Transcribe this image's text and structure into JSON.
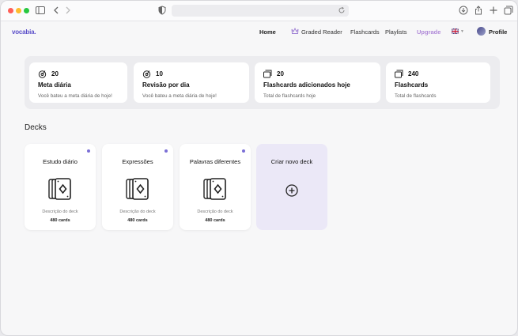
{
  "browser": {
    "icons": [
      "sidebar-icon",
      "back-icon",
      "forward-icon",
      "shield-icon",
      "reload-icon",
      "download-icon",
      "share-icon",
      "new-tab-icon",
      "tabs-icon"
    ]
  },
  "nav": {
    "logo": "vocabia.",
    "home": "Home",
    "graded_reader": "Graded Reader",
    "flashcards": "Flashcards",
    "playlists": "Playlists",
    "upgrade": "Upgrade",
    "profile": "Profile",
    "upgrade_color": "#b08ad8",
    "brand_color": "#5b4fc9"
  },
  "stats": [
    {
      "icon": "target-icon",
      "value": "20",
      "title": "Meta diária",
      "desc": "Você bateu a meta diária de hoje!"
    },
    {
      "icon": "target-icon",
      "value": "10",
      "title": "Revisão por dia",
      "desc": "Você bateu a meta diária de hoje!"
    },
    {
      "icon": "cards-icon",
      "value": "20",
      "title": "Flashcards adicionados hoje",
      "desc": "Total de flashcards hoje"
    },
    {
      "icon": "cards-icon",
      "value": "240",
      "title": "Flashcards",
      "desc": "Total de flashcards"
    }
  ],
  "decks_title": "Decks",
  "decks": [
    {
      "name": "Estudo diário",
      "desc": "Descrição do deck",
      "count": "480 cards"
    },
    {
      "name": "Expressões",
      "desc": "Descrição do deck",
      "count": "480 cards"
    },
    {
      "name": "Palavras diferentes",
      "desc": "Descrição do deck",
      "count": "480 cards"
    }
  ],
  "new_deck": "Criar novo deck"
}
